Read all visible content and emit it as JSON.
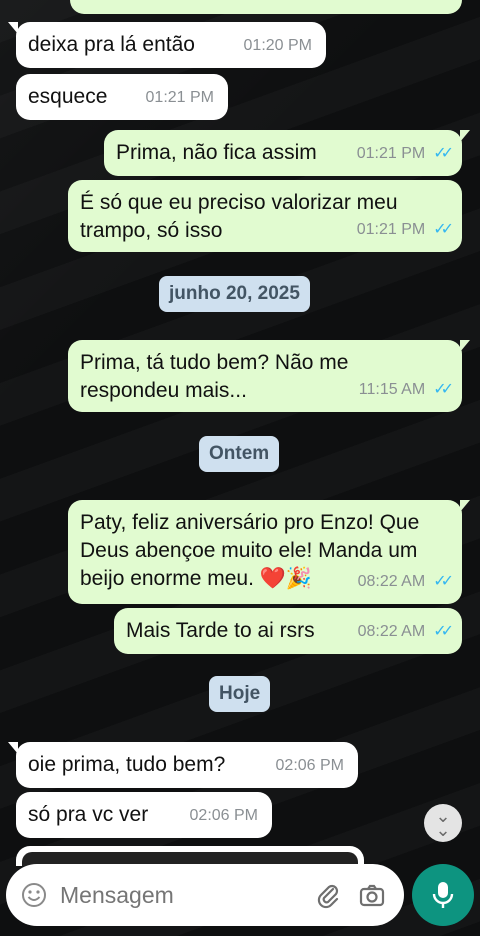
{
  "messages": [
    {
      "text": "deixa pra lá então",
      "time": "01:20 PM"
    },
    {
      "text": "esquece",
      "time": "01:21 PM"
    },
    {
      "text": "Prima, não fica assim",
      "time": "01:21 PM"
    },
    {
      "text": "É só que eu preciso valorizar meu trampo, só isso",
      "time": "01:21 PM"
    },
    {
      "text": "Prima, tá tudo bem? Não me respondeu mais...",
      "time": "11:15 AM"
    },
    {
      "text": "Paty, feliz aniversário pro Enzo! Que Deus abençoe muito ele! Manda um beijo enorme meu. ❤️🎉",
      "time": "08:22 AM"
    },
    {
      "text": "Mais Tarde to ai rsrs",
      "time": "08:22 AM"
    },
    {
      "text": "oie prima, tudo bem?",
      "time": "02:06 PM"
    },
    {
      "text": "só pra vc ver",
      "time": "02:06 PM"
    }
  ],
  "day_separators": [
    "junho 20, 2025",
    "Ontem",
    "Hoje"
  ],
  "composer": {
    "placeholder": "Mensagem"
  },
  "icons": {
    "emoji": "emoji-icon",
    "attach": "paperclip-icon",
    "camera": "camera-icon",
    "mic": "microphone-icon",
    "scroll": "chevrons-down-icon",
    "read": "double-check-icon"
  },
  "colors": {
    "incoming": "#ffffff",
    "outgoing": "#e1fbd0",
    "read_ticks": "#34b7f1",
    "mic_button": "#0d9480",
    "day_chip": "#cfe0ef"
  }
}
